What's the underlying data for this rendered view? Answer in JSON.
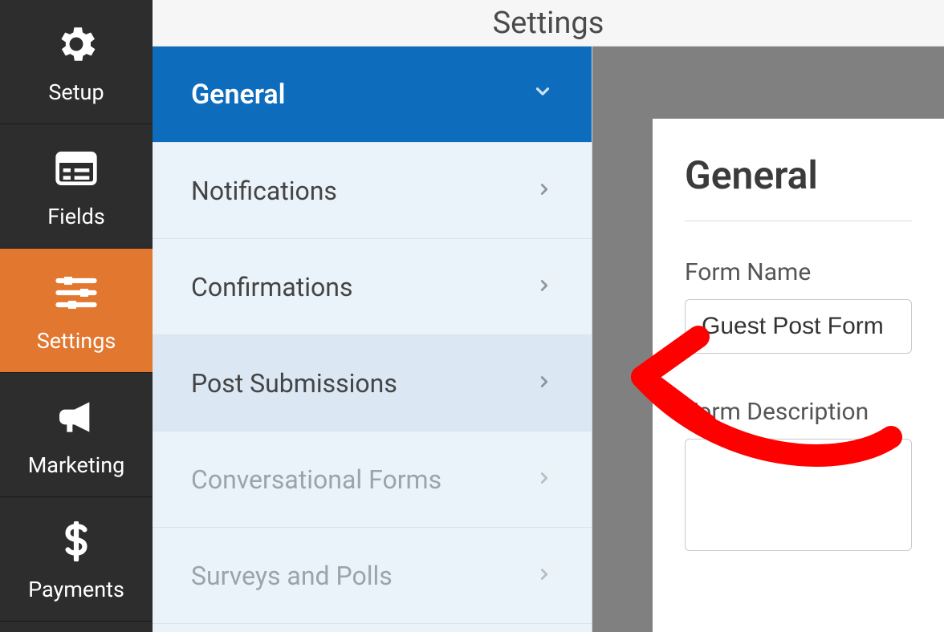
{
  "header": {
    "title": "Settings"
  },
  "sidebar": {
    "items": [
      {
        "label": "Setup",
        "icon": "gear-icon"
      },
      {
        "label": "Fields",
        "icon": "list-icon"
      },
      {
        "label": "Settings",
        "icon": "sliders-icon",
        "active": true
      },
      {
        "label": "Marketing",
        "icon": "megaphone-icon"
      },
      {
        "label": "Payments",
        "icon": "dollar-icon"
      }
    ]
  },
  "settings_list": {
    "items": [
      {
        "label": "General",
        "state": "open"
      },
      {
        "label": "Notifications",
        "state": "normal"
      },
      {
        "label": "Confirmations",
        "state": "normal"
      },
      {
        "label": "Post Submissions",
        "state": "hover"
      },
      {
        "label": "Conversational Forms",
        "state": "muted"
      },
      {
        "label": "Surveys and Polls",
        "state": "muted"
      }
    ]
  },
  "preview": {
    "title": "General",
    "form_name_label": "Form Name",
    "form_name_value": "Guest Post Form",
    "form_desc_label": "Form Description",
    "form_desc_value": ""
  },
  "annotation": {
    "type": "arrow",
    "color": "#ff0000"
  }
}
